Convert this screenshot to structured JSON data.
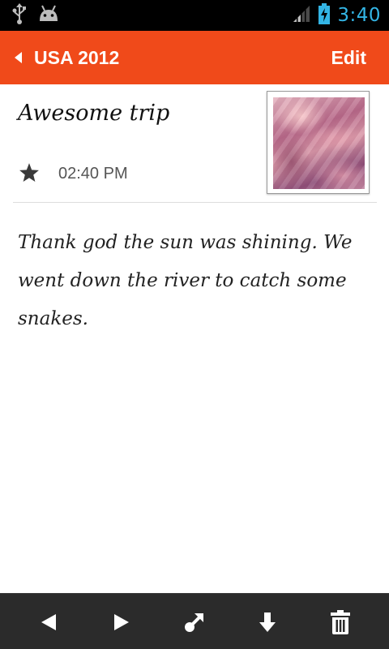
{
  "status_bar": {
    "time": "3:40",
    "icons": [
      "usb-icon",
      "android-icon",
      "signal-icon",
      "battery-charging-icon"
    ],
    "time_color": "#33b5e5"
  },
  "action_bar": {
    "title": "USA 2012",
    "edit_label": "Edit",
    "color": "#f04a1a"
  },
  "entry": {
    "title": "Awesome trip",
    "time": "02:40 PM",
    "body": "Thank god the sun was shining. We went down the river to catch some snakes."
  },
  "toolbar": {
    "icons": [
      "previous-icon",
      "next-icon",
      "share-icon",
      "download-icon",
      "delete-icon"
    ]
  }
}
